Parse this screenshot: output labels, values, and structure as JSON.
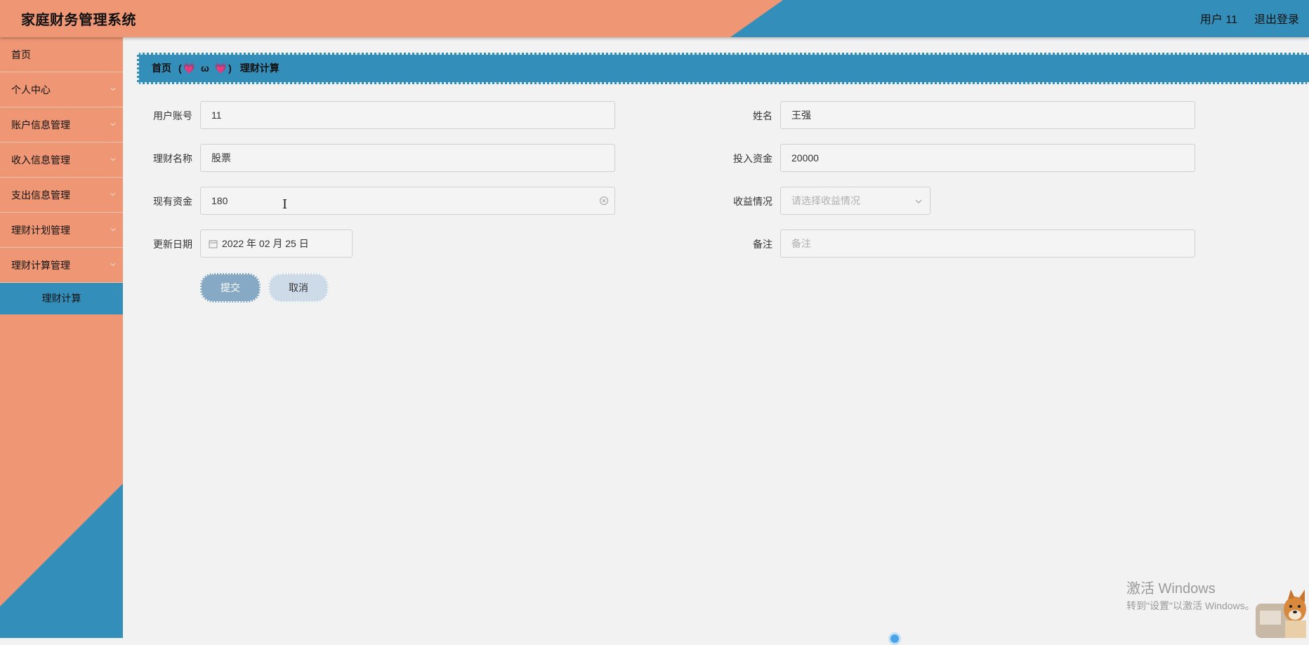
{
  "header": {
    "title": "家庭财务管理系统",
    "user_label": "用户 11",
    "logout_label": "退出登录"
  },
  "sidebar": {
    "items": [
      {
        "label": "首页",
        "has_chevron": false
      },
      {
        "label": "个人中心",
        "has_chevron": true
      },
      {
        "label": "账户信息管理",
        "has_chevron": true
      },
      {
        "label": "收入信息管理",
        "has_chevron": true
      },
      {
        "label": "支出信息管理",
        "has_chevron": true
      },
      {
        "label": "理财计划管理",
        "has_chevron": true
      },
      {
        "label": "理财计算管理",
        "has_chevron": true
      }
    ],
    "active_sub": "理财计算"
  },
  "breadcrumb": {
    "home": "首页",
    "separator": "(💗 ω 💗)",
    "current": "理财计算"
  },
  "form": {
    "account_label": "用户账号",
    "account_value": "11",
    "name_label": "姓名",
    "name_value": "王强",
    "product_label": "理财名称",
    "product_value": "股票",
    "investment_label": "投入资金",
    "investment_value": "20000",
    "current_label": "现有资金",
    "current_value": "180",
    "profit_label": "收益情况",
    "profit_placeholder": "请选择收益情况",
    "date_label": "更新日期",
    "date_value": "2022 年 02 月 25 日",
    "remark_label": "备注",
    "remark_placeholder": "备注"
  },
  "buttons": {
    "submit": "提交",
    "cancel": "取消"
  },
  "watermark": {
    "title": "激活 Windows",
    "subtitle": "转到\"设置\"以激活 Windows。"
  },
  "colors": {
    "orange": "#ef9774",
    "blue": "#338fba",
    "background": "#f2f2f2",
    "submit_bg": "#86a9c6",
    "cancel_bg": "#cddbe8"
  }
}
